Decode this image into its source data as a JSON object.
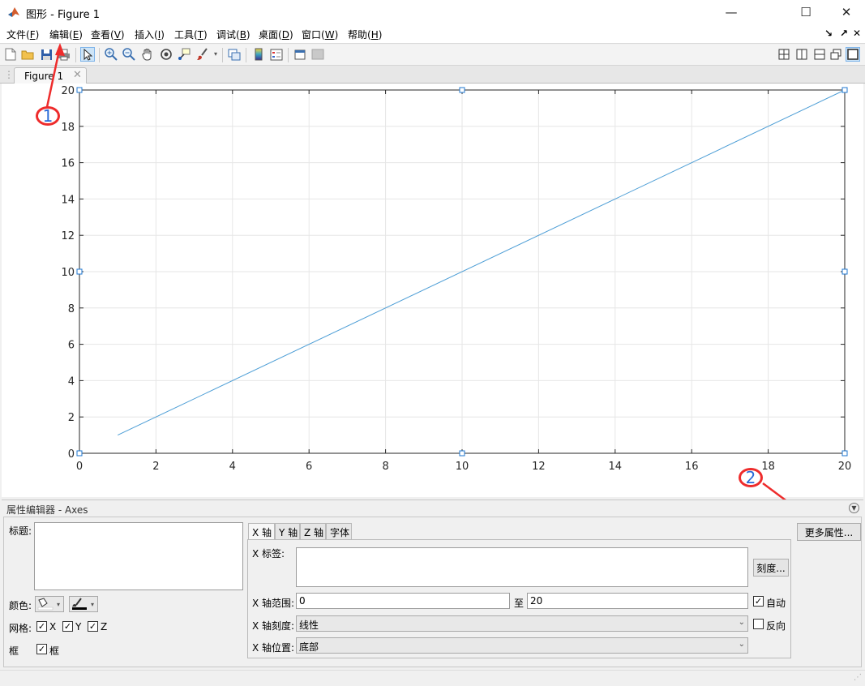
{
  "window": {
    "title": "图形 - Figure 1",
    "controls": {
      "minimize": "—",
      "maximize": "☐",
      "close": "✕"
    }
  },
  "menu": {
    "items": [
      {
        "label": "文件(",
        "key": "F",
        "suffix": ")"
      },
      {
        "label": "编辑(",
        "key": "E",
        "suffix": ")"
      },
      {
        "label": "查看(",
        "key": "V",
        "suffix": ")"
      },
      {
        "label": "插入(",
        "key": "I",
        "suffix": ")"
      },
      {
        "label": "工具(",
        "key": "T",
        "suffix": ")"
      },
      {
        "label": "调试(",
        "key": "B",
        "suffix": ")"
      },
      {
        "label": "桌面(",
        "key": "D",
        "suffix": ")"
      },
      {
        "label": "窗口(",
        "key": "W",
        "suffix": ")"
      },
      {
        "label": "帮助(",
        "key": "H",
        "suffix": ")"
      }
    ],
    "right": {
      "dock": "↘",
      "undock": "↗",
      "close": "✕"
    }
  },
  "toolbar": {
    "icons": [
      "new-figure-icon",
      "open-folder-icon",
      "save-icon",
      "print-icon",
      "select-arrow-icon",
      "zoom-in-icon",
      "zoom-out-icon",
      "pan-hand-icon",
      "rotate-3d-icon",
      "data-cursor-icon",
      "brush-icon",
      "link-plot-icon",
      "colorbar-icon",
      "legend-icon",
      "hide-plot-tools-icon",
      "show-plot-tools-icon"
    ],
    "layout_icons": [
      "tile-2x2-icon",
      "tile-columns-icon",
      "tile-rows-icon",
      "float-icon",
      "maximize-icon"
    ]
  },
  "figure_tab": {
    "label": "Figure 1",
    "close": "✕"
  },
  "chart_data": {
    "type": "line",
    "x": [
      1,
      20
    ],
    "y": [
      1,
      20
    ],
    "xlim": [
      0,
      20
    ],
    "ylim": [
      0,
      20
    ],
    "xticks": [
      "0",
      "2",
      "4",
      "6",
      "8",
      "10",
      "12",
      "14",
      "16",
      "18",
      "20"
    ],
    "yticks": [
      "0",
      "2",
      "4",
      "6",
      "8",
      "10",
      "12",
      "14",
      "16",
      "18",
      "20"
    ],
    "grid": true,
    "line_color": "#4d9ed6",
    "title": "",
    "xlabel": "",
    "ylabel": ""
  },
  "annotations": [
    {
      "number": "1",
      "color": "#ee2c2c"
    },
    {
      "number": "2",
      "color": "#ee2c2c"
    }
  ],
  "property_editor": {
    "title": "属性编辑器 - Axes",
    "left": {
      "title_label": "标题:",
      "color_label": "颜色:",
      "grid_label": "网格:",
      "grid_x": {
        "label": "X",
        "checked": true
      },
      "grid_y": {
        "label": "Y",
        "checked": true
      },
      "grid_z": {
        "label": "Z",
        "checked": true
      },
      "box_label": "框",
      "box_check": {
        "label": "框",
        "checked": true
      }
    },
    "tabs": [
      "X 轴",
      "Y 轴",
      "Z 轴",
      "字体"
    ],
    "x_axis": {
      "label_label": "X 标签:",
      "ticks_button": "刻度...",
      "range_label": "X 轴范围:",
      "range_min": "0",
      "to_label": "至",
      "range_max": "20",
      "auto": {
        "label": "自动",
        "checked": true
      },
      "scale_label": "X 轴刻度:",
      "scale_value": "线性",
      "reverse": {
        "label": "反向",
        "checked": false
      },
      "location_label": "X 轴位置:",
      "location_value": "底部"
    },
    "more_props_button": "更多属性..."
  }
}
